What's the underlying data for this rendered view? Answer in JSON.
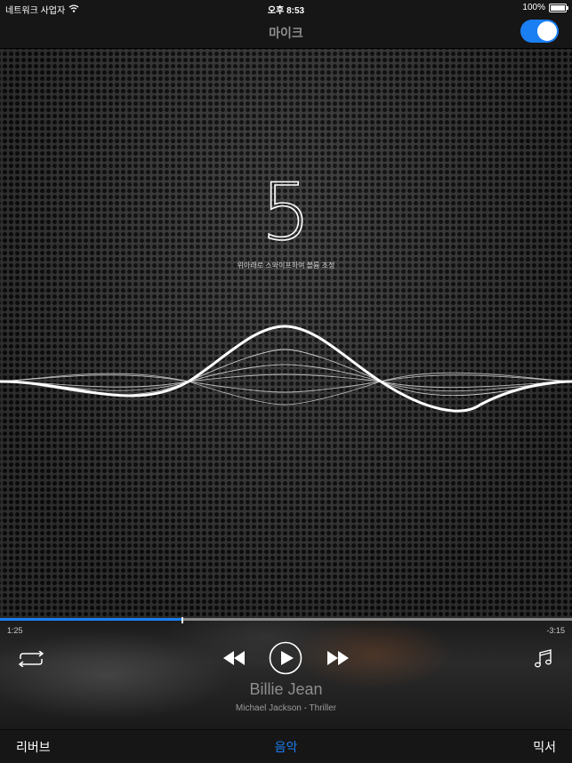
{
  "status_bar": {
    "network": "네트워크 사업자",
    "time": "오후 8:53",
    "battery": "100%"
  },
  "nav": {
    "title": "마이크",
    "mic_toggle_on": true
  },
  "volume": {
    "value": "5",
    "hint": "위아래로 스와이프하여 볼륨 조정"
  },
  "player": {
    "elapsed": "1:25",
    "remaining": "-3:15",
    "progress": 0.318,
    "song_title": "Billie Jean",
    "song_subtitle": "Michael Jackson - Thriller"
  },
  "tabs": {
    "reverb": "리버브",
    "music": "음악",
    "mixer": "믹서"
  },
  "colors": {
    "accent": "#1a7ff3"
  },
  "icons": [
    "wifi-icon",
    "battery-icon",
    "repeat-icon",
    "rewind-icon",
    "play-icon",
    "fast-forward-icon",
    "music-note-icon"
  ]
}
